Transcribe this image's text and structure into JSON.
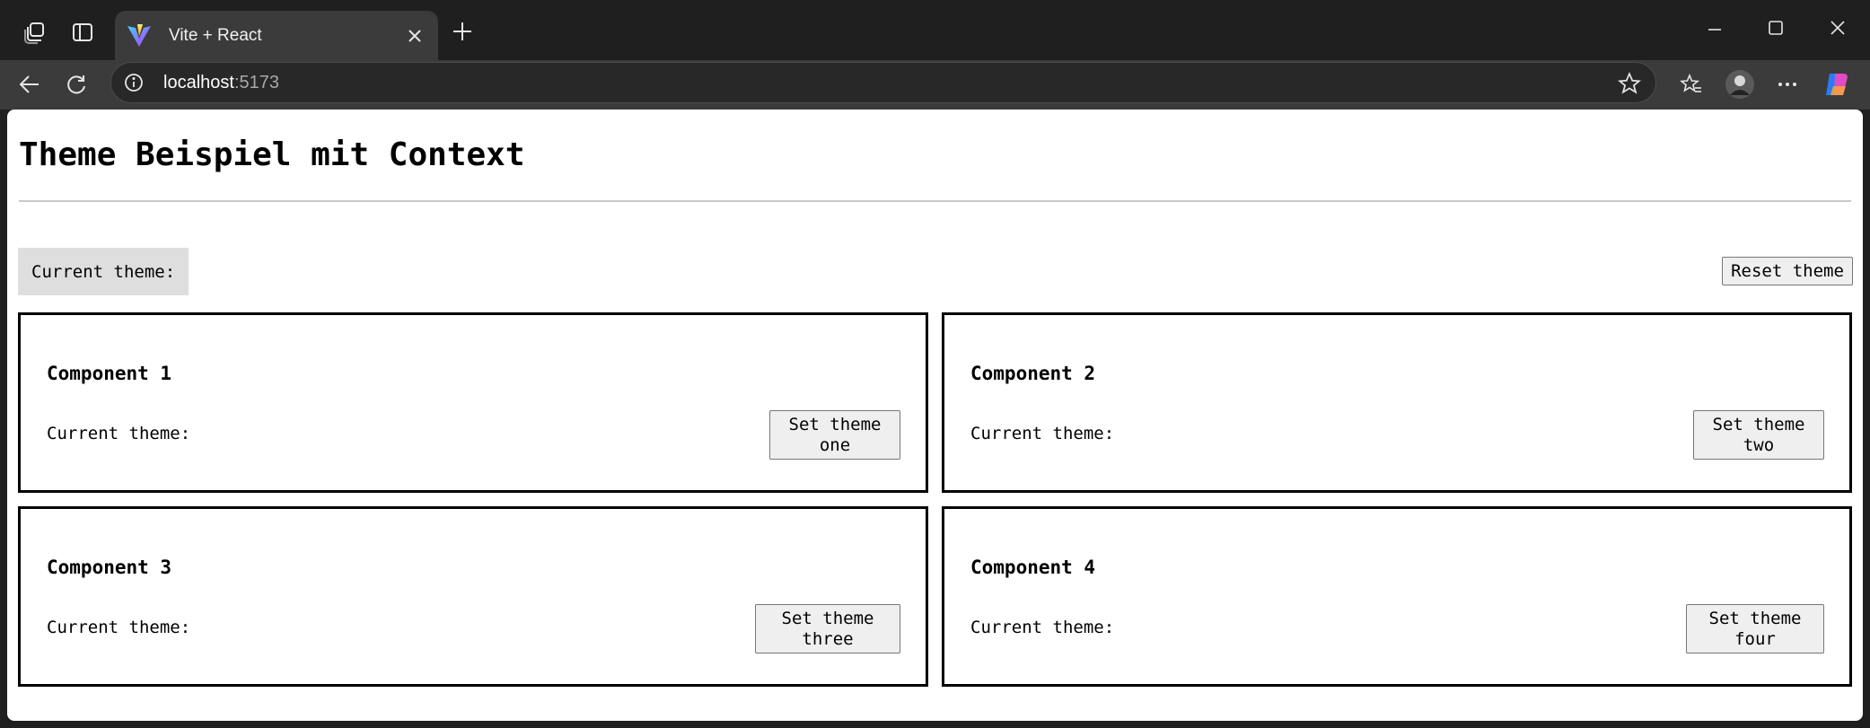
{
  "browser": {
    "tab": {
      "title": "Vite + React"
    },
    "address": {
      "host": "localhost",
      "port": ":5173"
    }
  },
  "page": {
    "title": "Theme Beispiel mit Context",
    "current_theme_label": "Current theme:",
    "reset_label": "Reset theme",
    "components": [
      {
        "title": "Component 1",
        "current_label": "Current theme:",
        "button_label": "Set theme one"
      },
      {
        "title": "Component 2",
        "current_label": "Current theme:",
        "button_label": "Set theme two"
      },
      {
        "title": "Component 3",
        "current_label": "Current theme:",
        "button_label": "Set theme three"
      },
      {
        "title": "Component 4",
        "current_label": "Current theme:",
        "button_label": "Set theme four"
      }
    ]
  }
}
